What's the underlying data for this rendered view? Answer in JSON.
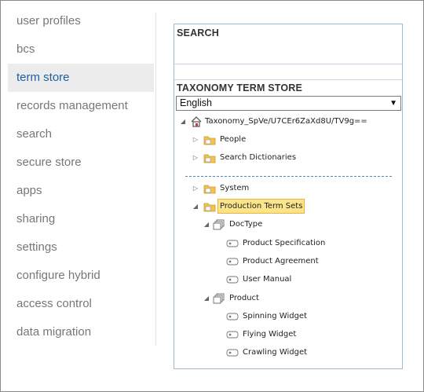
{
  "sidebar": {
    "items": [
      {
        "label": "user profiles"
      },
      {
        "label": "bcs"
      },
      {
        "label": "term store",
        "selected": true
      },
      {
        "label": "records management"
      },
      {
        "label": "search"
      },
      {
        "label": "secure store"
      },
      {
        "label": "apps"
      },
      {
        "label": "sharing"
      },
      {
        "label": "settings"
      },
      {
        "label": "configure hybrid"
      },
      {
        "label": "access control"
      },
      {
        "label": "data migration"
      }
    ]
  },
  "search_section": {
    "title": "SEARCH"
  },
  "taxonomy": {
    "title": "TAXONOMY TERM STORE",
    "language": "English",
    "root": "Taxonomy_SpVe/U7CEr6ZaXd8U/TV9g==",
    "groups": [
      {
        "label": "People"
      },
      {
        "label": "Search Dictionaries"
      },
      {
        "label": "System"
      },
      {
        "label": "Production Term Sets",
        "selected": true
      }
    ],
    "term_sets": [
      {
        "label": "DocType",
        "terms": [
          "Product Specification",
          "Product Agreement",
          "User Manual"
        ]
      },
      {
        "label": "Product",
        "terms": [
          "Spinning Widget",
          "Flying Widget",
          "Crawling Widget"
        ]
      }
    ]
  },
  "colors": {
    "selected_nav_text": "#1f5fa3",
    "selected_term_bg": "#fbe48a",
    "panel_border": "#9fb9d6",
    "separator": "#4c86c6"
  }
}
